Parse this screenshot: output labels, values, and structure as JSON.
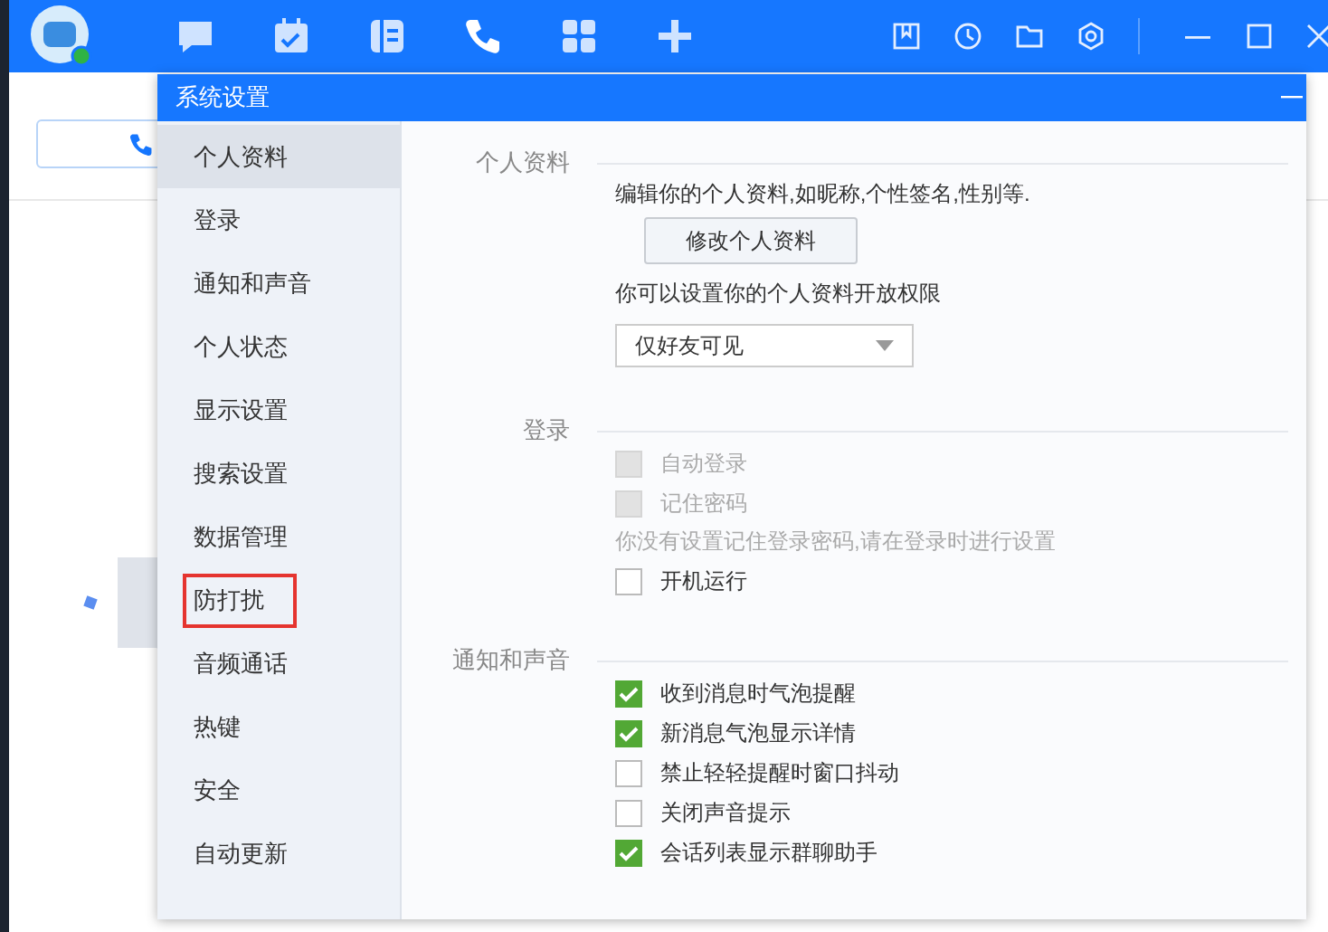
{
  "dialog": {
    "title": "系统设置",
    "sidebar": [
      {
        "label": "个人资料",
        "selected": true,
        "highlighted": false
      },
      {
        "label": "登录",
        "selected": false,
        "highlighted": false
      },
      {
        "label": "通知和声音",
        "selected": false,
        "highlighted": false
      },
      {
        "label": "个人状态",
        "selected": false,
        "highlighted": false
      },
      {
        "label": "显示设置",
        "selected": false,
        "highlighted": false
      },
      {
        "label": "搜索设置",
        "selected": false,
        "highlighted": false
      },
      {
        "label": "数据管理",
        "selected": false,
        "highlighted": false
      },
      {
        "label": "防打扰",
        "selected": false,
        "highlighted": true
      },
      {
        "label": "音频通话",
        "selected": false,
        "highlighted": false
      },
      {
        "label": "热键",
        "selected": false,
        "highlighted": false
      },
      {
        "label": "安全",
        "selected": false,
        "highlighted": false
      },
      {
        "label": "自动更新",
        "selected": false,
        "highlighted": false
      }
    ],
    "sections": [
      {
        "title": "个人资料",
        "items": [
          {
            "kind": "text",
            "text": "编辑你的个人资料,如昵称,个性签名,性别等."
          },
          {
            "kind": "button",
            "text": "修改个人资料"
          },
          {
            "kind": "text",
            "text": "你可以设置你的个人资料开放权限"
          },
          {
            "kind": "select",
            "text": "仅好友可见"
          }
        ]
      },
      {
        "title": "登录",
        "items": [
          {
            "kind": "checkbox",
            "text": "自动登录",
            "checked": false,
            "disabled": true
          },
          {
            "kind": "checkbox",
            "text": "记住密码",
            "checked": false,
            "disabled": true
          },
          {
            "kind": "note",
            "text": "你没有设置记住登录密码,请在登录时进行设置"
          },
          {
            "kind": "checkbox",
            "text": "开机运行",
            "checked": false,
            "disabled": false
          }
        ]
      },
      {
        "title": "通知和声音",
        "items": [
          {
            "kind": "checkbox",
            "text": "收到消息时气泡提醒",
            "checked": true,
            "disabled": false
          },
          {
            "kind": "checkbox",
            "text": "新消息气泡显示详情",
            "checked": true,
            "disabled": false
          },
          {
            "kind": "checkbox",
            "text": "禁止轻轻提醒时窗口抖动",
            "checked": false,
            "disabled": false
          },
          {
            "kind": "checkbox",
            "text": "关闭声音提示",
            "checked": false,
            "disabled": false
          },
          {
            "kind": "checkbox",
            "text": "会话列表显示群聊助手",
            "checked": true,
            "disabled": false
          }
        ]
      }
    ]
  }
}
